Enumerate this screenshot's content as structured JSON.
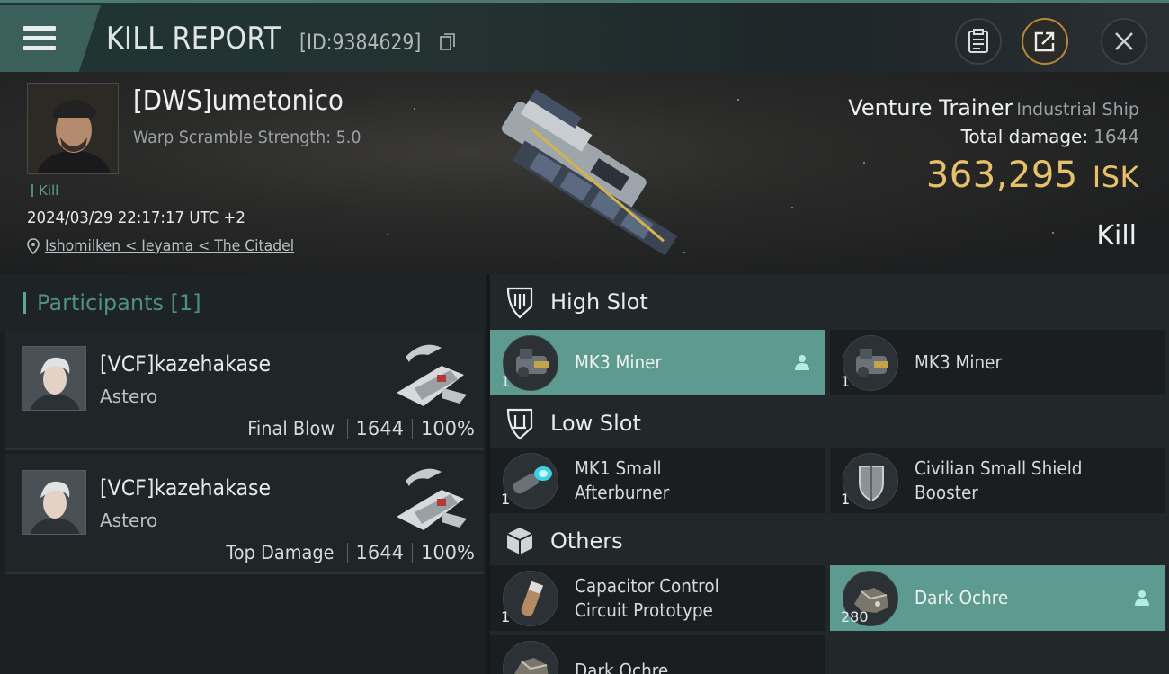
{
  "header": {
    "title": "KILL REPORT",
    "report_id": "[ID:9384629]"
  },
  "victim": {
    "name": "[DWS]umetonico",
    "warp_scramble": "Warp Scramble Strength: 5.0",
    "tag": "Kill",
    "timestamp": "2024/03/29 22:17:17 UTC +2",
    "location": "Ishomilken < Ieyama < The Citadel"
  },
  "ship": {
    "name": "Venture Trainer",
    "class": "Industrial Ship",
    "total_damage_label": "Total damage:",
    "total_damage": "1644",
    "isk_value": "363,295",
    "isk_unit": "ISK",
    "result": "Kill"
  },
  "participants": {
    "title": "Participants [1]",
    "items": [
      {
        "name": "[VCF]kazehakase",
        "ship": "Astero",
        "role": "Final Blow",
        "damage": "1644",
        "percent": "100%"
      },
      {
        "name": "[VCF]kazehakase",
        "ship": "Astero",
        "role": "Top Damage",
        "damage": "1644",
        "percent": "100%"
      }
    ]
  },
  "fitting": {
    "high_slot": {
      "label": "High Slot",
      "items": [
        {
          "name": "MK3 Miner",
          "qty": "1",
          "icon": "miner-module-icon",
          "action": "pilot-icon"
        },
        {
          "name": "MK3 Miner",
          "qty": "1",
          "icon": "miner-module-icon",
          "action": "close-icon"
        }
      ]
    },
    "low_slot": {
      "label": "Low Slot",
      "items": [
        {
          "name_line1": "MK1 Small",
          "name_line2": "Afterburner",
          "qty": "1",
          "icon": "afterburner-icon",
          "action": "close-icon"
        },
        {
          "name_line1": "Civilian Small Shield",
          "name_line2": "Booster",
          "qty": "1",
          "icon": "shield-booster-icon",
          "action": "close-icon"
        }
      ]
    },
    "others": {
      "label": "Others",
      "items": [
        {
          "name_line1": "Capacitor Control",
          "name_line2": "Circuit Prototype",
          "qty": "1",
          "icon": "capacitor-circuit-icon",
          "action": "close-icon"
        },
        {
          "name": "Dark Ochre",
          "qty": "280",
          "icon": "ore-icon",
          "action": "pilot-icon"
        },
        {
          "name": "Dark Ochre",
          "qty": "",
          "icon": "ore-icon",
          "action": "close-icon"
        }
      ]
    }
  },
  "colors": {
    "accent_teal": "#5d9a8f",
    "isk_gold": "#e7c06a",
    "header_orange": "#b8863b"
  }
}
